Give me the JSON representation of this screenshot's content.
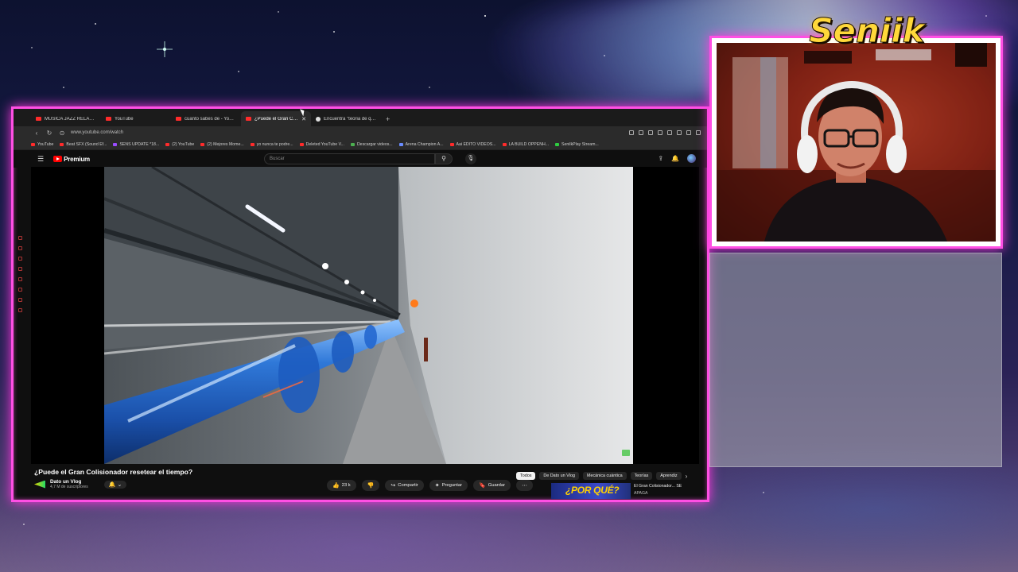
{
  "streamer": {
    "name": "Seniik"
  },
  "browser": {
    "tabs": [
      {
        "label": "MÚSICA JAZZ RELAJANTE",
        "active": false
      },
      {
        "label": "YouTube",
        "active": false
      },
      {
        "label": "cuanto sabes de - YouTube",
        "active": false
      },
      {
        "label": "¿Puede el Gran Colisio...",
        "active": true
      },
      {
        "label": "Encuentra \"teoria de que...",
        "active": false
      }
    ],
    "url": "www.youtube.com/watch",
    "bookmarks": [
      "YouTube",
      "Beat SFX (Sound Ef...",
      "SENS UPDATE *18...",
      "(2) YouTube",
      "(2) Mejores Mome...",
      "yo nunca te podre...",
      "Deleted YouTube V...",
      "Descargar videos...",
      "Arena Champion A...",
      "Aai EDITO VIDEOS...",
      "LA BUILD OPPENH...",
      "SenilkPlay Stream..."
    ]
  },
  "youtube": {
    "brand": "Premium",
    "search_placeholder": "Buscar",
    "video": {
      "title": "¿Puede el Gran Colisionador resetear el tiempo?",
      "channel": "Dato un Vlog",
      "subscribers": "4,7 M de suscriptores"
    },
    "actions": {
      "likes": "23 k",
      "share": "Compartir",
      "ask": "Preguntar",
      "save": "Guardar"
    },
    "chips": [
      "Todos",
      "De Dato un Vlog",
      "Mecánica cuántica",
      "Teorías",
      "Aprendiz"
    ],
    "recommended": {
      "thumb_text": "¿POR QUÉ?",
      "title": "El Gran Colisionador... SE",
      "subtitle": "APAGA"
    }
  },
  "colors": {
    "accent": "#ff4fe4",
    "name_color": "#ffd83a",
    "youtube_red": "#ff0000"
  }
}
